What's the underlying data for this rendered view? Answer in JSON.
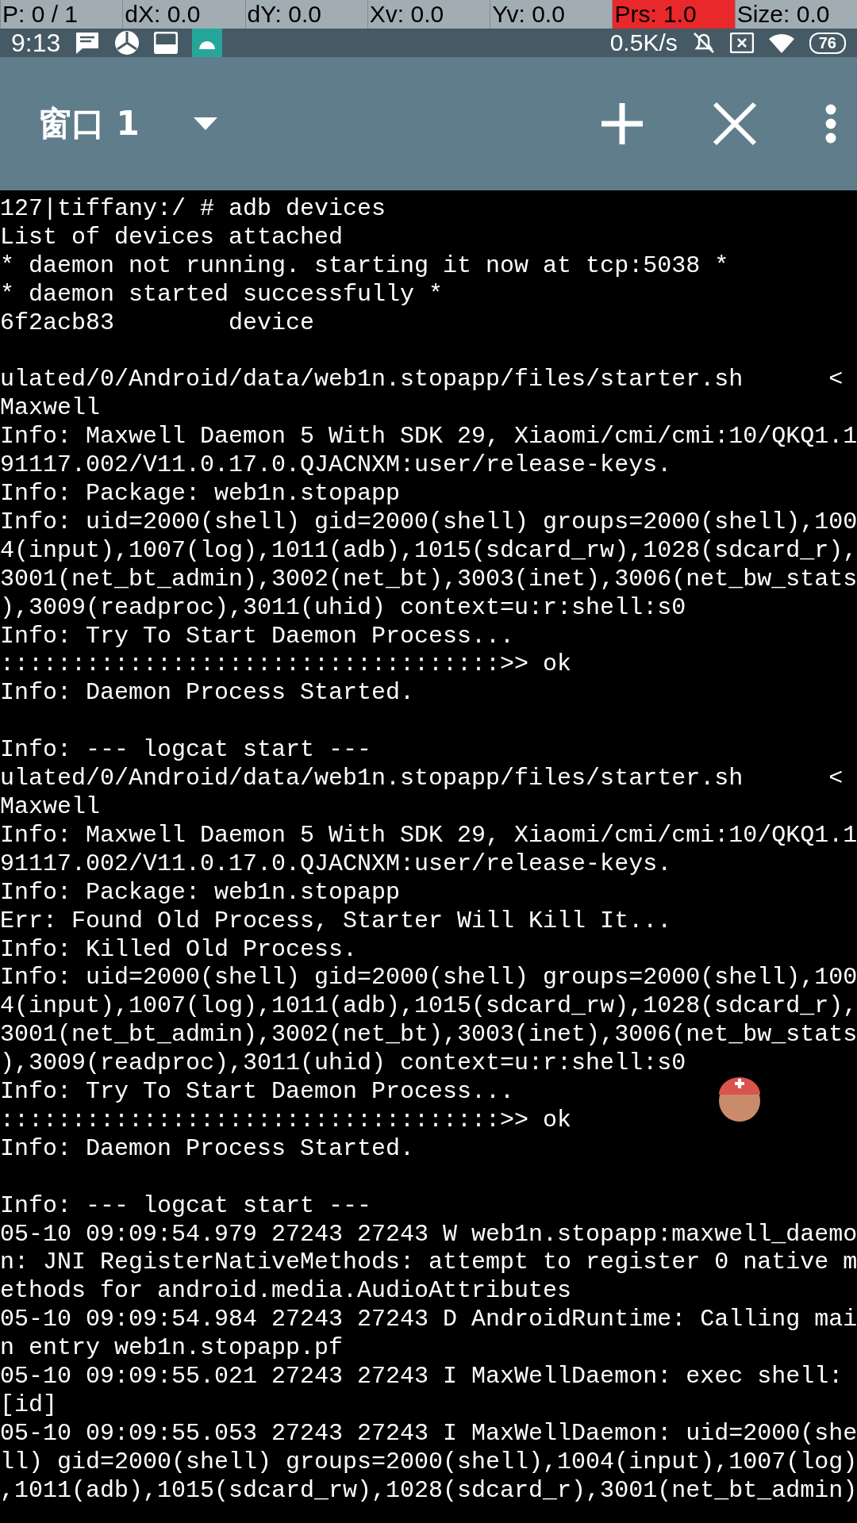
{
  "pointer_overlay": [
    {
      "text": "P: 0 / 1",
      "highlighted": false
    },
    {
      "text": "dX: 0.0",
      "highlighted": false
    },
    {
      "text": "dY: 0.0",
      "highlighted": false
    },
    {
      "text": "Xv: 0.0",
      "highlighted": false
    },
    {
      "text": "Yv: 0.0",
      "highlighted": false
    },
    {
      "text": "Prs: 1.0",
      "highlighted": true
    },
    {
      "text": "Size: 0.0",
      "highlighted": false
    }
  ],
  "status_bar": {
    "time": "9:13",
    "net_speed": "0.5K/s",
    "battery": "76"
  },
  "toolbar": {
    "title": "窗口 1"
  },
  "terminal": {
    "blocks": [
      [
        "127|tiffany:/ # adb devices",
        "List of devices attached",
        "* daemon not running. starting it now at tcp:5038 *",
        "* daemon started successfully *",
        "6f2acb83        device"
      ],
      [
        "ulated/0/Android/data/web1n.stopapp/files/starter.sh      <",
        "Maxwell",
        "Info: Maxwell Daemon 5 With SDK 29, Xiaomi/cmi/cmi:10/QKQ1.1",
        "91117.002/V11.0.17.0.QJACNXM:user/release-keys.",
        "Info: Package: web1n.stopapp",
        "Info: uid=2000(shell) gid=2000(shell) groups=2000(shell),100",
        "4(input),1007(log),1011(adb),1015(sdcard_rw),1028(sdcard_r),",
        "3001(net_bt_admin),3002(net_bt),3003(inet),3006(net_bw_stats",
        "),3009(readproc),3011(uhid) context=u:r:shell:s0",
        "Info: Try To Start Daemon Process...",
        ":::::::::::::::::::::::::::::::::::>> ok",
        "Info: Daemon Process Started."
      ],
      [
        "Info: --- logcat start ---",
        "ulated/0/Android/data/web1n.stopapp/files/starter.sh      <",
        "Maxwell",
        "Info: Maxwell Daemon 5 With SDK 29, Xiaomi/cmi/cmi:10/QKQ1.1",
        "91117.002/V11.0.17.0.QJACNXM:user/release-keys.",
        "Info: Package: web1n.stopapp",
        "Err: Found Old Process, Starter Will Kill It...",
        "Info: Killed Old Process.",
        "Info: uid=2000(shell) gid=2000(shell) groups=2000(shell),100",
        "4(input),1007(log),1011(adb),1015(sdcard_rw),1028(sdcard_r),",
        "3001(net_bt_admin),3002(net_bt),3003(inet),3006(net_bw_stats",
        "),3009(readproc),3011(uhid) context=u:r:shell:s0",
        "Info: Try To Start Daemon Process...",
        ":::::::::::::::::::::::::::::::::::>> ok",
        "Info: Daemon Process Started."
      ],
      [
        "Info: --- logcat start ---",
        "05-10 09:09:54.979 27243 27243 W web1n.stopapp:maxwell_daemo",
        "n: JNI RegisterNativeMethods: attempt to register 0 native m",
        "ethods for android.media.AudioAttributes",
        "05-10 09:09:54.984 27243 27243 D AndroidRuntime: Calling mai",
        "n entry web1n.stopapp.pf",
        "05-10 09:09:55.021 27243 27243 I MaxWellDaemon: exec shell:",
        "[id]",
        "05-10 09:09:55.053 27243 27243 I MaxWellDaemon: uid=2000(she",
        "ll) gid=2000(shell) groups=2000(shell),1004(input),1007(log)",
        ",1011(adb),1015(sdcard_rw),1028(sdcard_r),3001(net_bt_admin)"
      ]
    ]
  }
}
